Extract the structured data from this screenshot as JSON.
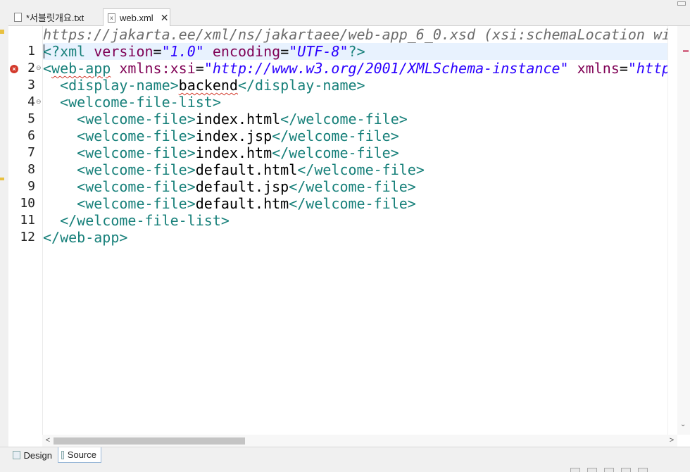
{
  "tabs": [
    {
      "label": "*서블릿개요.txt",
      "active": false,
      "icon": "text-file-icon"
    },
    {
      "label": "web.xml",
      "active": true,
      "icon": "xml-file-icon",
      "close": "✕"
    }
  ],
  "editor": {
    "hint_line": "https://jakarta.ee/xml/ns/jakartaee/web-app_6_0.xsd (xsi:schemaLocation wi",
    "line_numbers": [
      "1",
      "2",
      "3",
      "4",
      "5",
      "6",
      "7",
      "8",
      "9",
      "10",
      "11",
      "12"
    ],
    "lines": {
      "l1": {
        "open": "<?",
        "tag": "xml",
        "a1": " version",
        "eq1": "=",
        "v1": "\"1.0\"",
        "a2": " encoding",
        "eq2": "=",
        "v2": "\"UTF-8\"",
        "close": "?>"
      },
      "l2": {
        "open": "<",
        "tag": "web-app",
        "a1": " xmlns:xsi",
        "eq1": "=",
        "v1": "\"http://www.w3.org/2001/XMLSchema-instance\"",
        "a2": " xmlns",
        "eq2": "=",
        "v2": "\"http"
      },
      "l3": {
        "indent": "  ",
        "open": "<display-name>",
        "text": "backend",
        "close": "</display-name>"
      },
      "l4": {
        "indent": "  ",
        "open": "<welcome-file-list>"
      },
      "l5": {
        "indent": "    ",
        "open": "<welcome-file>",
        "text": "index.html",
        "close": "</welcome-file>"
      },
      "l6": {
        "indent": "    ",
        "open": "<welcome-file>",
        "text": "index.jsp",
        "close": "</welcome-file>"
      },
      "l7": {
        "indent": "    ",
        "open": "<welcome-file>",
        "text": "index.htm",
        "close": "</welcome-file>"
      },
      "l8": {
        "indent": "    ",
        "open": "<welcome-file>",
        "text": "default.html",
        "close": "</welcome-file>"
      },
      "l9": {
        "indent": "    ",
        "open": "<welcome-file>",
        "text": "default.jsp",
        "close": "</welcome-file>"
      },
      "l10": {
        "indent": "    ",
        "open": "<welcome-file>",
        "text": "default.htm",
        "close": "</welcome-file>"
      },
      "l11": {
        "indent": "  ",
        "open": "</welcome-file-list>"
      },
      "l12": {
        "indent": "",
        "open": "</web-app>"
      }
    },
    "colors": {
      "tag": "#17807a",
      "attr": "#7f0055",
      "value": "#2a00ff",
      "error": "#d33a2c",
      "current_line": "#e8f2fe"
    }
  },
  "scroll": {
    "left_arrow": "<",
    "right_arrow": ">"
  },
  "bottom_tabs": [
    {
      "label": "Design",
      "active": false
    },
    {
      "label": "Source",
      "active": true
    }
  ]
}
